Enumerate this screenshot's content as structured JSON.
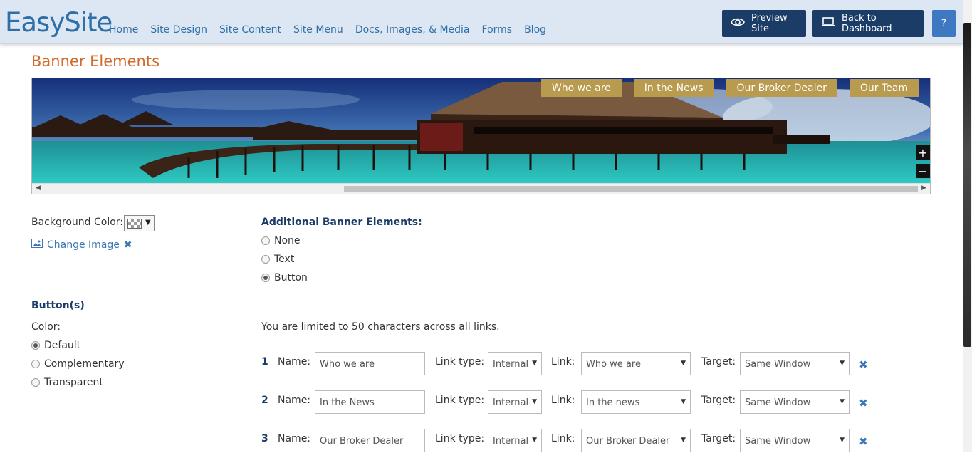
{
  "header": {
    "logo": "EasySite",
    "nav": [
      "Home",
      "Site Design",
      "Site Content",
      "Site Menu",
      "Docs, Images, & Media",
      "Forms",
      "Blog"
    ],
    "preview_label": "Preview Site",
    "dashboard_label": "Back to Dashboard",
    "help_label": "?"
  },
  "page": {
    "title": "Banner Elements"
  },
  "banner": {
    "links": [
      "Who we are",
      "In the News",
      "Our Broker Dealer",
      "Our Team"
    ],
    "zoom_in": "+",
    "zoom_out": "−"
  },
  "settings": {
    "bg_color_label": "Background Color:",
    "change_image_label": "Change Image",
    "additional_heading": "Additional Banner Elements:",
    "additional_options": [
      {
        "label": "None",
        "selected": false
      },
      {
        "label": "Text",
        "selected": false
      },
      {
        "label": "Button",
        "selected": true
      }
    ],
    "buttons_heading": "Button(s)",
    "color_label": "Color:",
    "color_options": [
      {
        "label": "Default",
        "selected": true
      },
      {
        "label": "Complementary",
        "selected": false
      },
      {
        "label": "Transparent",
        "selected": false
      }
    ],
    "limit_text": "You are limited to 50 characters across all links."
  },
  "link_rows": [
    {
      "num": "1",
      "name_label": "Name:",
      "name": "Who we are",
      "type_label": "Link type:",
      "type": "Internal",
      "link_label": "Link:",
      "link": "Who we are",
      "target_label": "Target:",
      "target": "Same Window"
    },
    {
      "num": "2",
      "name_label": "Name:",
      "name": "In the News",
      "type_label": "Link type:",
      "type": "Internal",
      "link_label": "Link:",
      "link": "In the news",
      "target_label": "Target:",
      "target": "Same Window"
    },
    {
      "num": "3",
      "name_label": "Name:",
      "name": "Our Broker Dealer",
      "type_label": "Link type:",
      "type": "Internal",
      "link_label": "Link:",
      "link": "Our Broker Dealer",
      "target_label": "Target:",
      "target": "Same Window"
    }
  ],
  "colors": {
    "brand": "#2f6fa8",
    "dark_button": "#1b3c67",
    "title_orange": "#d2692d",
    "banner_link_gold": "#b89b4e"
  }
}
